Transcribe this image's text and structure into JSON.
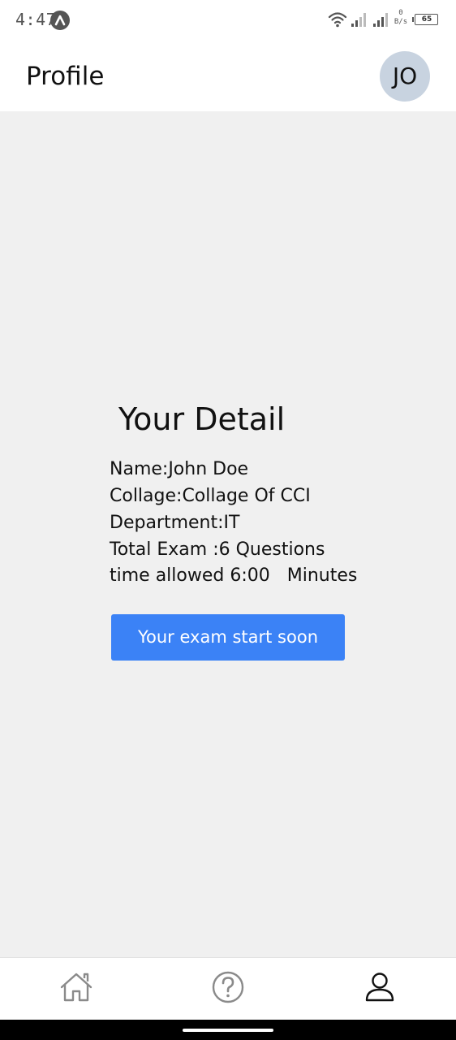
{
  "status_bar": {
    "time": "4:47",
    "battery_level": "65",
    "network_speed_value": "0",
    "network_speed_unit": "B/s"
  },
  "header": {
    "title": "Profile",
    "avatar_initials": "JO"
  },
  "detail": {
    "title": "Your Detail",
    "name_line": "Name:John Doe",
    "college_line": "Collage:Collage Of CCI",
    "department_line": "Department:IT",
    "total_exam_line": "Total Exam :6 Questions",
    "time_allowed_line": "time allowed 6:00   Minutes",
    "button_label": "Your exam start soon"
  },
  "bottom_nav": {
    "items": [
      {
        "icon": "home-icon",
        "active": false
      },
      {
        "icon": "help-icon",
        "active": false
      },
      {
        "icon": "user-icon",
        "active": true
      }
    ]
  },
  "colors": {
    "accent": "#3b82f6",
    "avatar_bg": "#c8d3e0",
    "background": "#f0f0f0"
  }
}
